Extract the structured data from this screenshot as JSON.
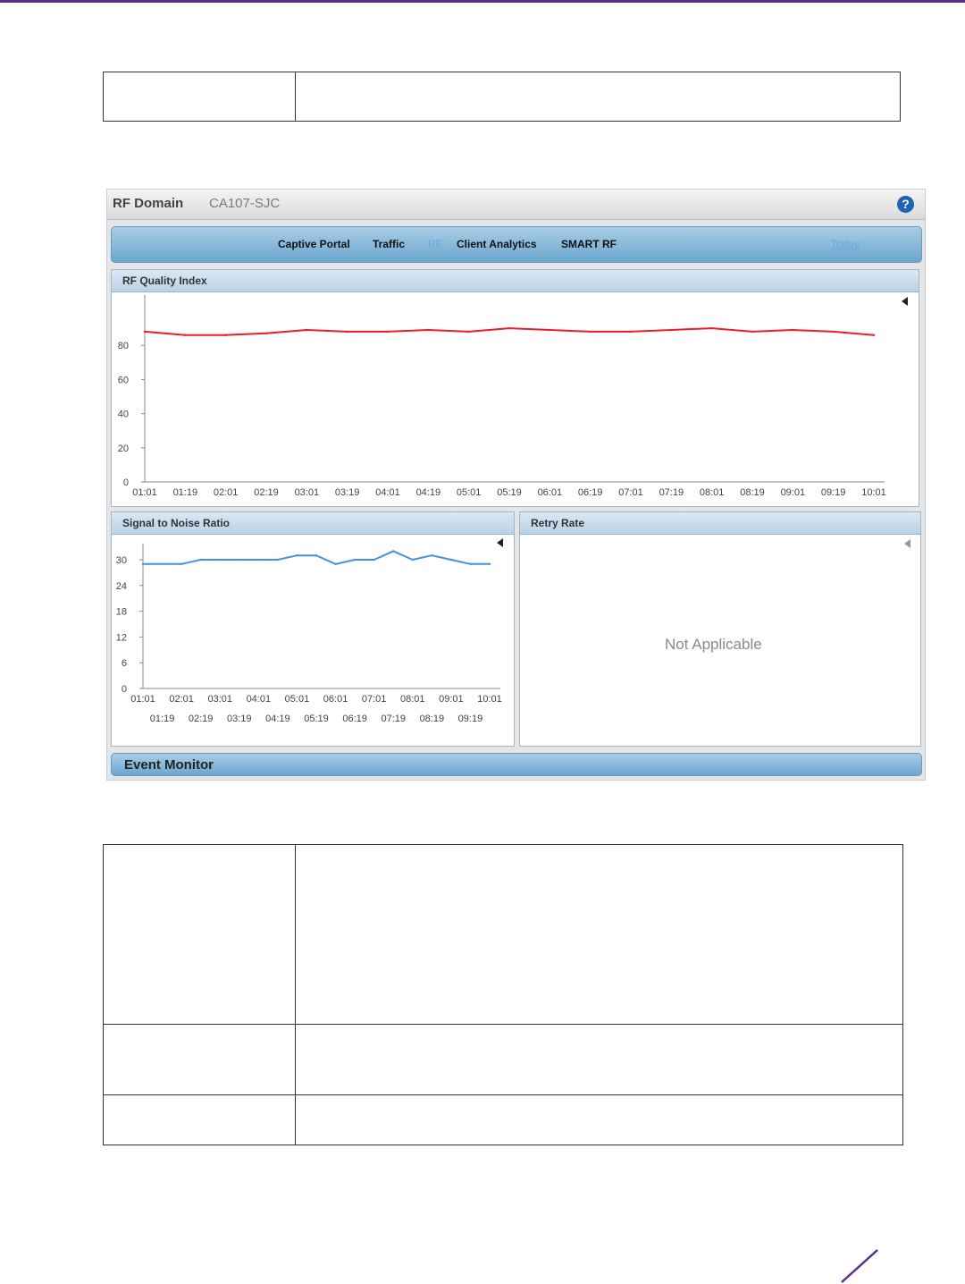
{
  "brand": {
    "accent": "#5b2d8e"
  },
  "window": {
    "title": "RF Domain",
    "domain_name": "CA107-SJC"
  },
  "icons": {
    "help": "help-icon",
    "collapse": "collapse-arrow-icon",
    "corner": "corner-slash"
  },
  "tabs": [
    {
      "label": "Captive Portal",
      "state": "normal"
    },
    {
      "label": "Traffic",
      "state": "normal"
    },
    {
      "label": "RF",
      "state": "active"
    },
    {
      "label": "Client Analytics",
      "state": "normal"
    },
    {
      "label": "SMART RF",
      "state": "normal"
    },
    {
      "label": "Today",
      "state": "link"
    }
  ],
  "panels": {
    "rf_quality": {
      "title": "RF Quality Index"
    },
    "snr": {
      "title": "Signal to Noise Ratio"
    },
    "retry": {
      "title": "Retry Rate",
      "message": "Not Applicable"
    }
  },
  "event_monitor": {
    "title": "Event Monitor"
  },
  "chart_data": [
    {
      "type": "line",
      "title": "RF Quality Index",
      "x": [
        "01:01",
        "01:19",
        "02:01",
        "02:19",
        "03:01",
        "03:19",
        "04:01",
        "04:19",
        "05:01",
        "05:19",
        "06:01",
        "06:19",
        "07:01",
        "07:19",
        "08:01",
        "08:19",
        "09:01",
        "09:19",
        "10:01"
      ],
      "ylim": [
        0,
        100
      ],
      "yticks": [
        0,
        20,
        40,
        60,
        80
      ],
      "color": "#ee1c25",
      "series": [
        {
          "values": [
            88,
            86,
            86,
            87,
            89,
            88,
            88,
            89,
            88,
            90,
            89,
            88,
            88,
            89,
            90,
            88,
            89,
            88,
            86
          ]
        }
      ]
    },
    {
      "type": "line",
      "title": "Signal to Noise Ratio",
      "x": [
        "01:01",
        "01:19",
        "02:01",
        "02:19",
        "03:01",
        "03:19",
        "04:01",
        "04:19",
        "05:01",
        "05:19",
        "06:01",
        "06:19",
        "07:01",
        "07:19",
        "08:01",
        "08:19",
        "09:01",
        "09:19",
        "10:01"
      ],
      "x_tick_rows": [
        [
          "01:01",
          "02:01",
          "03:01",
          "04:01",
          "05:01",
          "06:01",
          "07:01",
          "08:01",
          "09:01",
          "10:01"
        ],
        [
          "01:19",
          "02:19",
          "03:19",
          "04:19",
          "05:19",
          "06:19",
          "07:19",
          "08:19",
          "09:19"
        ]
      ],
      "ylim": [
        0,
        30
      ],
      "yticks": [
        0,
        6,
        12,
        18,
        24,
        30
      ],
      "color": "#4a90d9",
      "series": [
        {
          "values": [
            29,
            29,
            29,
            30,
            30,
            30,
            30,
            30,
            31,
            31,
            29,
            30,
            30,
            32,
            30,
            31,
            30,
            29,
            29
          ]
        }
      ]
    },
    {
      "type": "line",
      "title": "Retry Rate",
      "note": "Not Applicable"
    }
  ]
}
